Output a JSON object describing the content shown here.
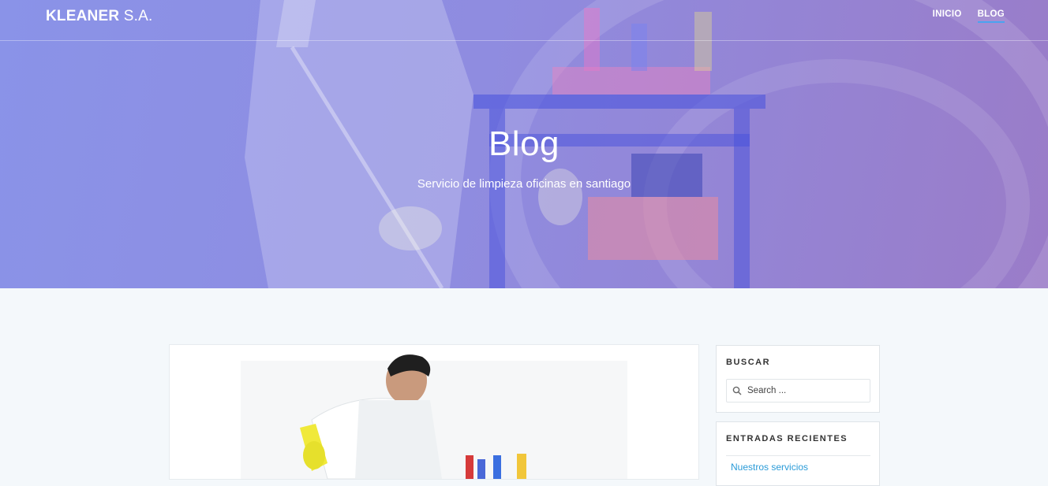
{
  "header": {
    "brand_bold": "KLEANER",
    "brand_light": "S.A.",
    "nav": [
      {
        "label": "INICIO",
        "active": false
      },
      {
        "label": "BLOG",
        "active": true
      }
    ]
  },
  "hero": {
    "title": "Blog",
    "subtitle": "Servicio de limpieza oficinas en santiago"
  },
  "sidebar": {
    "search": {
      "title": "BUSCAR",
      "placeholder": "Search ..."
    },
    "recent": {
      "title": "ENTRADAS RECIENTES",
      "items": [
        "Nuestros servicios"
      ]
    }
  },
  "colors": {
    "hero_gradient_start": "#8a93e8",
    "hero_gradient_end": "#9a7cc8",
    "nav_active_underline": "#4aa3f0",
    "link": "#2a9bd8",
    "page_bg": "#f4f8fb"
  },
  "icons": {
    "search": "search-icon"
  }
}
